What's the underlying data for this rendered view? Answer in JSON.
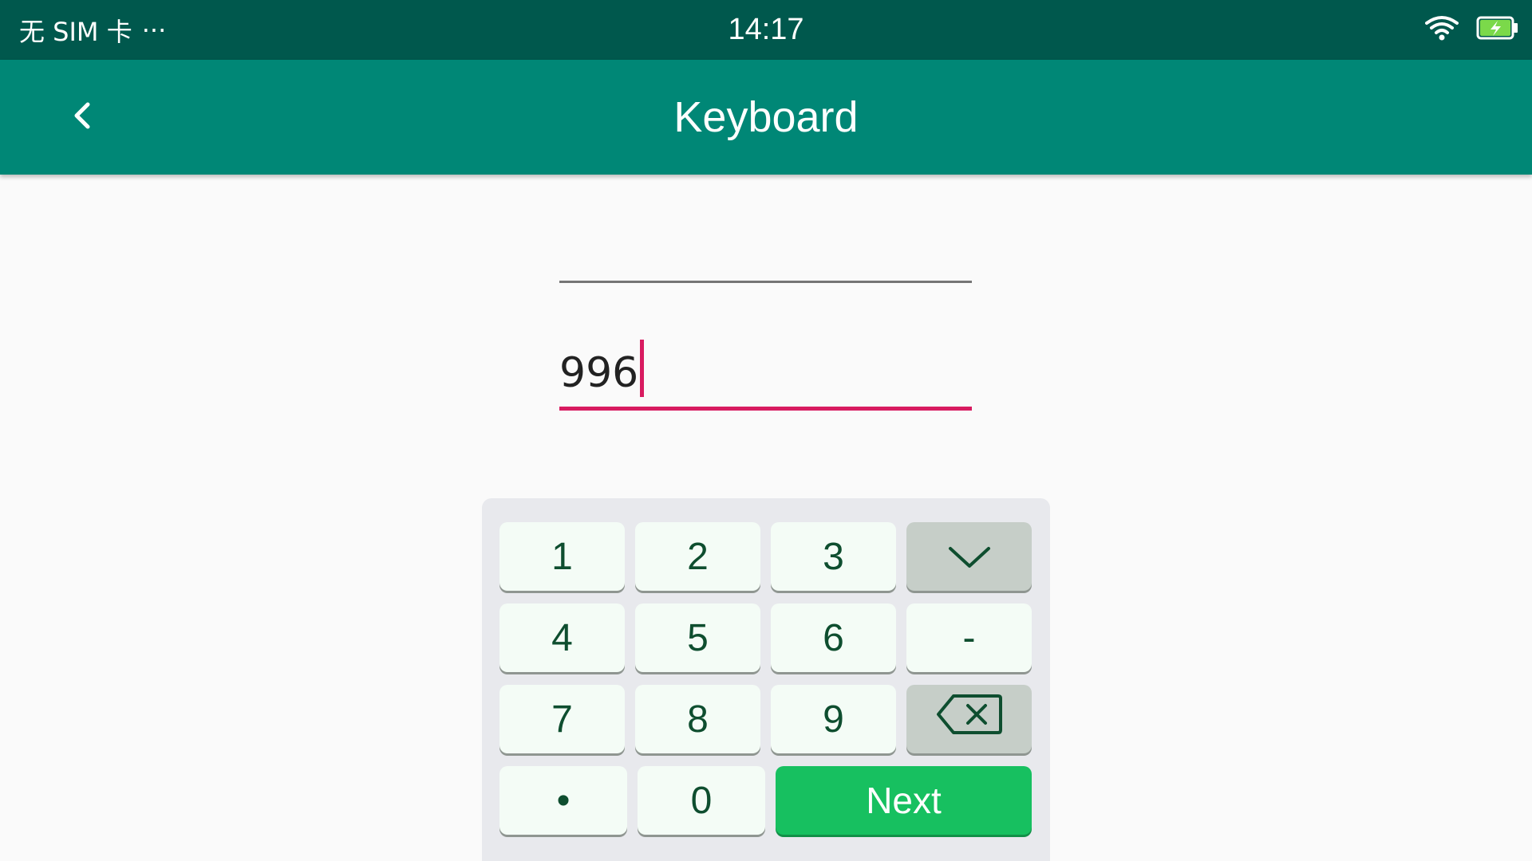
{
  "status_bar": {
    "carrier": "无 SIM 卡",
    "more": "···",
    "time": "14:17",
    "icons": [
      "wifi-icon",
      "battery-charging-icon"
    ],
    "battery_color": "#7bd94a"
  },
  "app_bar": {
    "back_icon": "chevron-left-icon",
    "title": "Keyboard",
    "color": "#008776"
  },
  "fields": [
    {
      "value": ""
    },
    {
      "value": "996",
      "focused": true,
      "accent": "#d81b60"
    }
  ],
  "keypad": {
    "keys": [
      "1",
      "2",
      "3",
      "4",
      "5",
      "6",
      "-",
      "7",
      "8",
      "9",
      "•",
      "0"
    ],
    "collapse_icon": "chevron-down-icon",
    "backspace_icon": "backspace-icon",
    "next_label": "Next",
    "next_color": "#17c060"
  }
}
